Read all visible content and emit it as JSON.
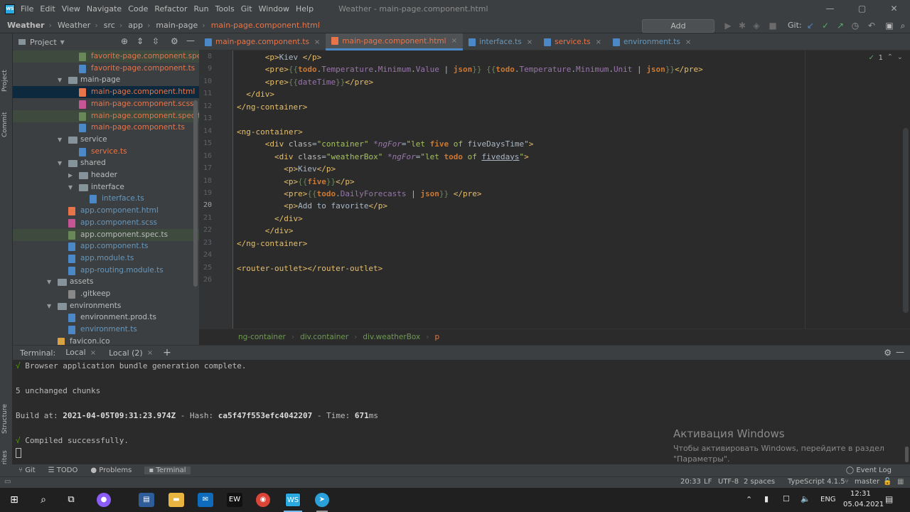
{
  "menubar": {
    "items": [
      "File",
      "Edit",
      "View",
      "Navigate",
      "Code",
      "Refactor",
      "Run",
      "Tools",
      "Git",
      "Window",
      "Help"
    ],
    "window_title": "Weather - main-page.component.html",
    "controls": [
      "—",
      "▢",
      "✕"
    ]
  },
  "navbar": {
    "crumbs": [
      "Weather",
      "Weather",
      "src",
      "app",
      "main-page",
      "main-page.component.html"
    ],
    "add_config": "Add Configuration...",
    "git_label": "Git:"
  },
  "project_panel": {
    "title": "Project",
    "side_tabs": [
      "Project",
      "Commit",
      "Structure",
      "Favorites"
    ],
    "tree": [
      {
        "label": "favorite-page.component.spec",
        "indent": 111,
        "kind": "file",
        "color": "#e8754a",
        "icon": "#6a8759",
        "selected": "olive"
      },
      {
        "label": "favorite-page.component.ts",
        "indent": 111,
        "kind": "file",
        "color": "#e8754a",
        "icon": "#4a88c7"
      },
      {
        "label": "main-page",
        "indent": 96,
        "kind": "folder",
        "color": "#bbbbbb",
        "arrow": "▼"
      },
      {
        "label": "main-page.component.html",
        "indent": 111,
        "kind": "file",
        "color": "#e8754a",
        "icon": "#e8754a",
        "selected": "blue"
      },
      {
        "label": "main-page.component.scss",
        "indent": 111,
        "kind": "file",
        "color": "#e8754a",
        "icon": "#c65596"
      },
      {
        "label": "main-page.component.spec.ts",
        "indent": 111,
        "kind": "file",
        "color": "#e8754a",
        "icon": "#6a8759",
        "selected": "olive"
      },
      {
        "label": "main-page.component.ts",
        "indent": 111,
        "kind": "file",
        "color": "#e8754a",
        "icon": "#4a88c7"
      },
      {
        "label": "service",
        "indent": 96,
        "kind": "folder",
        "color": "#bbbbbb",
        "arrow": "▼"
      },
      {
        "label": "service.ts",
        "indent": 111,
        "kind": "file",
        "color": "#e8754a",
        "icon": "#4a88c7"
      },
      {
        "label": "shared",
        "indent": 96,
        "kind": "folder",
        "color": "#bbbbbb",
        "arrow": "▼"
      },
      {
        "label": "header",
        "indent": 111,
        "kind": "folder",
        "color": "#bbbbbb",
        "arrow": "▶"
      },
      {
        "label": "interface",
        "indent": 111,
        "kind": "folder",
        "color": "#bbbbbb",
        "arrow": "▼"
      },
      {
        "label": "interface.ts",
        "indent": 126,
        "kind": "file",
        "color": "#6897bb",
        "icon": "#4a88c7"
      },
      {
        "label": "app.component.html",
        "indent": 96,
        "kind": "file",
        "color": "#6897bb",
        "icon": "#e8754a"
      },
      {
        "label": "app.component.scss",
        "indent": 96,
        "kind": "file",
        "color": "#6897bb",
        "icon": "#c65596"
      },
      {
        "label": "app.component.spec.ts",
        "indent": 96,
        "kind": "file",
        "color": "#bbbbbb",
        "icon": "#6a8759",
        "selected": "olive"
      },
      {
        "label": "app.component.ts",
        "indent": 96,
        "kind": "file",
        "color": "#6897bb",
        "icon": "#4a88c7"
      },
      {
        "label": "app.module.ts",
        "indent": 96,
        "kind": "file",
        "color": "#6897bb",
        "icon": "#4a88c7"
      },
      {
        "label": "app-routing.module.ts",
        "indent": 96,
        "kind": "file",
        "color": "#6897bb",
        "icon": "#4a88c7"
      },
      {
        "label": "assets",
        "indent": 81,
        "kind": "folder",
        "color": "#bbbbbb",
        "arrow": "▼"
      },
      {
        "label": ".gitkeep",
        "indent": 96,
        "kind": "file",
        "color": "#bbbbbb",
        "icon": "#888888"
      },
      {
        "label": "environments",
        "indent": 81,
        "kind": "folder",
        "color": "#bbbbbb",
        "arrow": "▼"
      },
      {
        "label": "environment.prod.ts",
        "indent": 96,
        "kind": "file",
        "color": "#bbbbbb",
        "icon": "#4a88c7"
      },
      {
        "label": "environment.ts",
        "indent": 96,
        "kind": "file",
        "color": "#6897bb",
        "icon": "#4a88c7"
      },
      {
        "label": "favicon.ico",
        "indent": 81,
        "kind": "file",
        "color": "#bbbbbb",
        "icon": "#d9a343"
      }
    ]
  },
  "tabs": [
    {
      "label": "main-page.component.ts",
      "color": "#e8754a",
      "icon": "#4a88c7",
      "active": false
    },
    {
      "label": "main-page.component.html",
      "color": "#e8754a",
      "icon": "#e8754a",
      "active": true
    },
    {
      "label": "interface.ts",
      "color": "#6897bb",
      "icon": "#4a88c7",
      "active": false
    },
    {
      "label": "service.ts",
      "color": "#e8754a",
      "icon": "#4a88c7",
      "active": false
    },
    {
      "label": "environment.ts",
      "color": "#6897bb",
      "icon": "#4a88c7",
      "active": false
    }
  ],
  "editor": {
    "inspection": "1",
    "lines": [
      {
        "n": "8",
        "segs": [
          [
            "      ",
            "id"
          ],
          [
            "<p>",
            "tag"
          ],
          [
            "Kiev ",
            "id"
          ],
          [
            "</p>",
            "tag"
          ]
        ]
      },
      {
        "n": "9",
        "segs": [
          [
            "      ",
            "id"
          ],
          [
            "<pre>",
            "tag"
          ],
          [
            "{{",
            "brace"
          ],
          [
            "todo",
            "kw"
          ],
          [
            ".",
            "id"
          ],
          [
            "Temperature",
            "prop"
          ],
          [
            ".",
            "id"
          ],
          [
            "Minimum",
            "prop"
          ],
          [
            ".",
            "id"
          ],
          [
            "Value",
            "prop"
          ],
          [
            " | ",
            "id"
          ],
          [
            "json",
            "kw"
          ],
          [
            "}}",
            "brace"
          ],
          [
            " ",
            "id"
          ],
          [
            "{{",
            "brace"
          ],
          [
            "todo",
            "kw"
          ],
          [
            ".",
            "id"
          ],
          [
            "Temperature",
            "prop"
          ],
          [
            ".",
            "id"
          ],
          [
            "Minimum",
            "prop"
          ],
          [
            ".",
            "id"
          ],
          [
            "Unit",
            "prop"
          ],
          [
            " | ",
            "id"
          ],
          [
            "json",
            "kw"
          ],
          [
            "}}",
            "brace"
          ],
          [
            "</pre>",
            "tag"
          ]
        ]
      },
      {
        "n": "10",
        "segs": [
          [
            "      ",
            "id"
          ],
          [
            "<pre>",
            "tag"
          ],
          [
            "{{",
            "brace"
          ],
          [
            "dateTime",
            "prop"
          ],
          [
            "}}",
            "brace"
          ],
          [
            "</pre>",
            "tag"
          ]
        ]
      },
      {
        "n": "11",
        "segs": [
          [
            "  ",
            "id"
          ],
          [
            "</div>",
            "tag"
          ]
        ]
      },
      {
        "n": "12",
        "segs": [
          [
            "</ng-container>",
            "tag"
          ]
        ]
      },
      {
        "n": "13",
        "segs": []
      },
      {
        "n": "14",
        "segs": [
          [
            "<ng-container>",
            "tag"
          ]
        ]
      },
      {
        "n": "15",
        "segs": [
          [
            "      ",
            "id"
          ],
          [
            "<div ",
            "tag"
          ],
          [
            "class",
            "attr"
          ],
          [
            "=",
            "id"
          ],
          [
            "\"container\" ",
            "str"
          ],
          [
            "*ngFor",
            "ng"
          ],
          [
            "=",
            "id"
          ],
          [
            "\"",
            "str"
          ],
          [
            "let ",
            "str"
          ],
          [
            "five",
            "kw"
          ],
          [
            " of ",
            "str"
          ],
          [
            "fiveDaysTime",
            "id"
          ],
          [
            "\"",
            "str"
          ],
          [
            ">",
            "tag"
          ]
        ]
      },
      {
        "n": "16",
        "segs": [
          [
            "        ",
            "id"
          ],
          [
            "<div ",
            "tag"
          ],
          [
            "class",
            "attr"
          ],
          [
            "=",
            "id"
          ],
          [
            "\"weatherBox\" ",
            "str"
          ],
          [
            "*ngFor",
            "ng"
          ],
          [
            "=",
            "id"
          ],
          [
            "\"",
            "str"
          ],
          [
            "let ",
            "str"
          ],
          [
            "todo",
            "kw"
          ],
          [
            " of ",
            "str"
          ],
          [
            "fivedays",
            "id"
          ],
          [
            "\"",
            "str"
          ],
          [
            ">",
            "tag"
          ]
        ]
      },
      {
        "n": "17",
        "segs": [
          [
            "          ",
            "id"
          ],
          [
            "<p>",
            "tag"
          ],
          [
            "Kiev",
            "id"
          ],
          [
            "</p>",
            "tag"
          ]
        ]
      },
      {
        "n": "18",
        "segs": [
          [
            "          ",
            "id"
          ],
          [
            "<p>",
            "tag"
          ],
          [
            "{{",
            "brace"
          ],
          [
            "five",
            "kw"
          ],
          [
            "}}",
            "brace"
          ],
          [
            "</p>",
            "tag"
          ]
        ]
      },
      {
        "n": "19",
        "segs": [
          [
            "          ",
            "id"
          ],
          [
            "<pre>",
            "tag"
          ],
          [
            "{{",
            "brace"
          ],
          [
            "todo",
            "kw"
          ],
          [
            ".",
            "id"
          ],
          [
            "DailyForecasts",
            "prop"
          ],
          [
            " | ",
            "id"
          ],
          [
            "json",
            "kw"
          ],
          [
            "}}",
            "brace"
          ],
          [
            " ",
            "id"
          ],
          [
            "</pre>",
            "tag"
          ]
        ]
      },
      {
        "n": "20",
        "segs": [
          [
            "          ",
            "id"
          ],
          [
            "<p>",
            "tag"
          ],
          [
            "Add to favorite",
            "id"
          ],
          [
            "</p>",
            "tag"
          ]
        ]
      },
      {
        "n": "21",
        "segs": [
          [
            "        ",
            "id"
          ],
          [
            "</div>",
            "tag"
          ]
        ]
      },
      {
        "n": "22",
        "segs": [
          [
            "      ",
            "id"
          ],
          [
            "</div>",
            "tag"
          ]
        ]
      },
      {
        "n": "23",
        "segs": [
          [
            "</ng-container>",
            "tag"
          ]
        ]
      },
      {
        "n": "24",
        "segs": []
      },
      {
        "n": "25",
        "segs": [
          [
            "<router-outlet>",
            "tag"
          ],
          [
            "</router-outlet>",
            "tag"
          ]
        ]
      },
      {
        "n": "26",
        "segs": []
      }
    ],
    "breadcrumb": [
      "ng-container",
      "div.container",
      "div.weatherBox",
      "p"
    ]
  },
  "terminal": {
    "label": "Terminal:",
    "tabs": [
      "Local",
      "Local (2)"
    ],
    "add": "+",
    "line1": "Browser application bundle generation complete.",
    "line2": "5 unchanged chunks",
    "build_prefix": "Build at: ",
    "build_date": "2021-04-05T09:31:23.974Z",
    "hash_prefix": " - Hash: ",
    "hash": "ca5f47f553efc4042207",
    "time_prefix": " - Time: ",
    "time": "671",
    "time_unit": "ms",
    "line4": "Compiled successfully.",
    "check": "√"
  },
  "watermark": {
    "title": "Активация Windows",
    "line1": "Чтобы активировать Windows, перейдите в раздел",
    "line2": "\"Параметры\"."
  },
  "toolwindows": {
    "items": [
      "Git",
      "TODO",
      "Problems",
      "Terminal"
    ],
    "event_log": "Event Log"
  },
  "status": {
    "position": "20:33",
    "line_sep": "LF",
    "encoding": "UTF-8",
    "indent": "2 spaces",
    "lang": "TypeScript 4.1.5",
    "branch": "master"
  },
  "taskbar": {
    "lang": "ENG",
    "time": "12:31",
    "date": "05.04.2021"
  }
}
